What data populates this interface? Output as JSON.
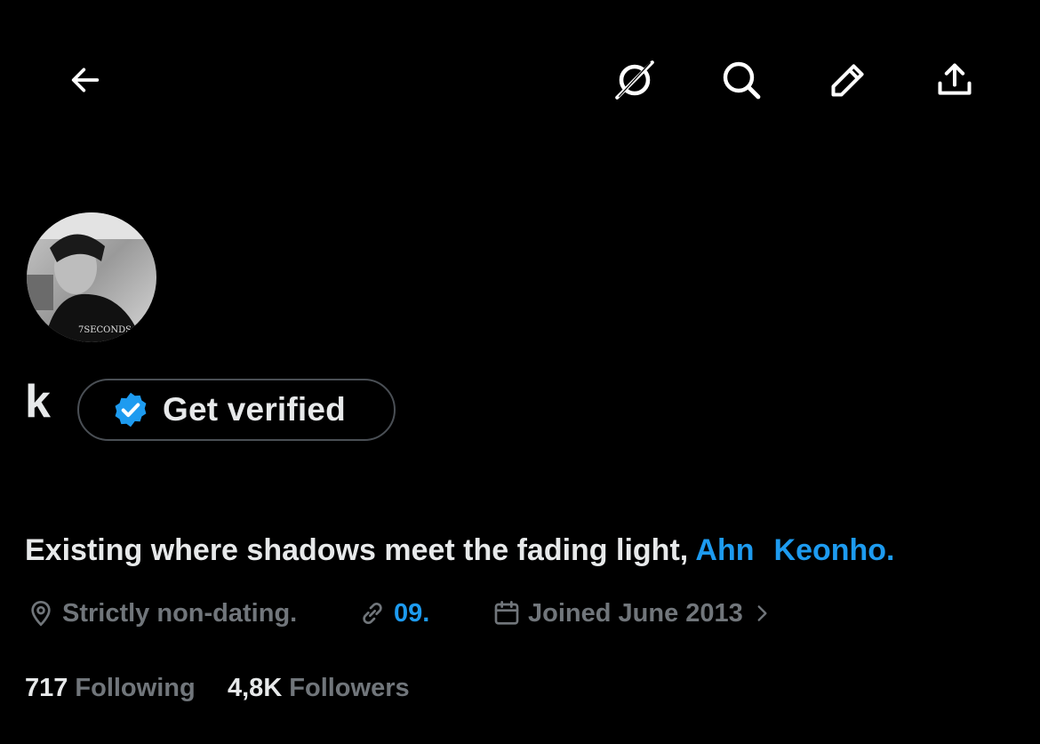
{
  "header": {
    "icons": [
      "back-arrow-icon",
      "grok-icon",
      "search-icon",
      "edit-pencil-icon",
      "share-icon"
    ]
  },
  "profile": {
    "name": "k",
    "avatar_text": "7SECONDS",
    "verify_button_label": "Get verified",
    "bio_text": "Existing where shadows meet the fading light,",
    "bio_mention_1": "Ahn",
    "bio_mention_2": "Keonho.",
    "location": "Strictly non-dating.",
    "link": "09.",
    "joined": "Joined June 2013",
    "following_count": "717",
    "following_label": "Following",
    "followers_count": "4,8K",
    "followers_label": "Followers"
  },
  "colors": {
    "background": "#000000",
    "text_primary": "#e7e9ea",
    "text_secondary": "#71767b",
    "accent": "#1d9bf0",
    "button_border": "#4a4f55"
  }
}
